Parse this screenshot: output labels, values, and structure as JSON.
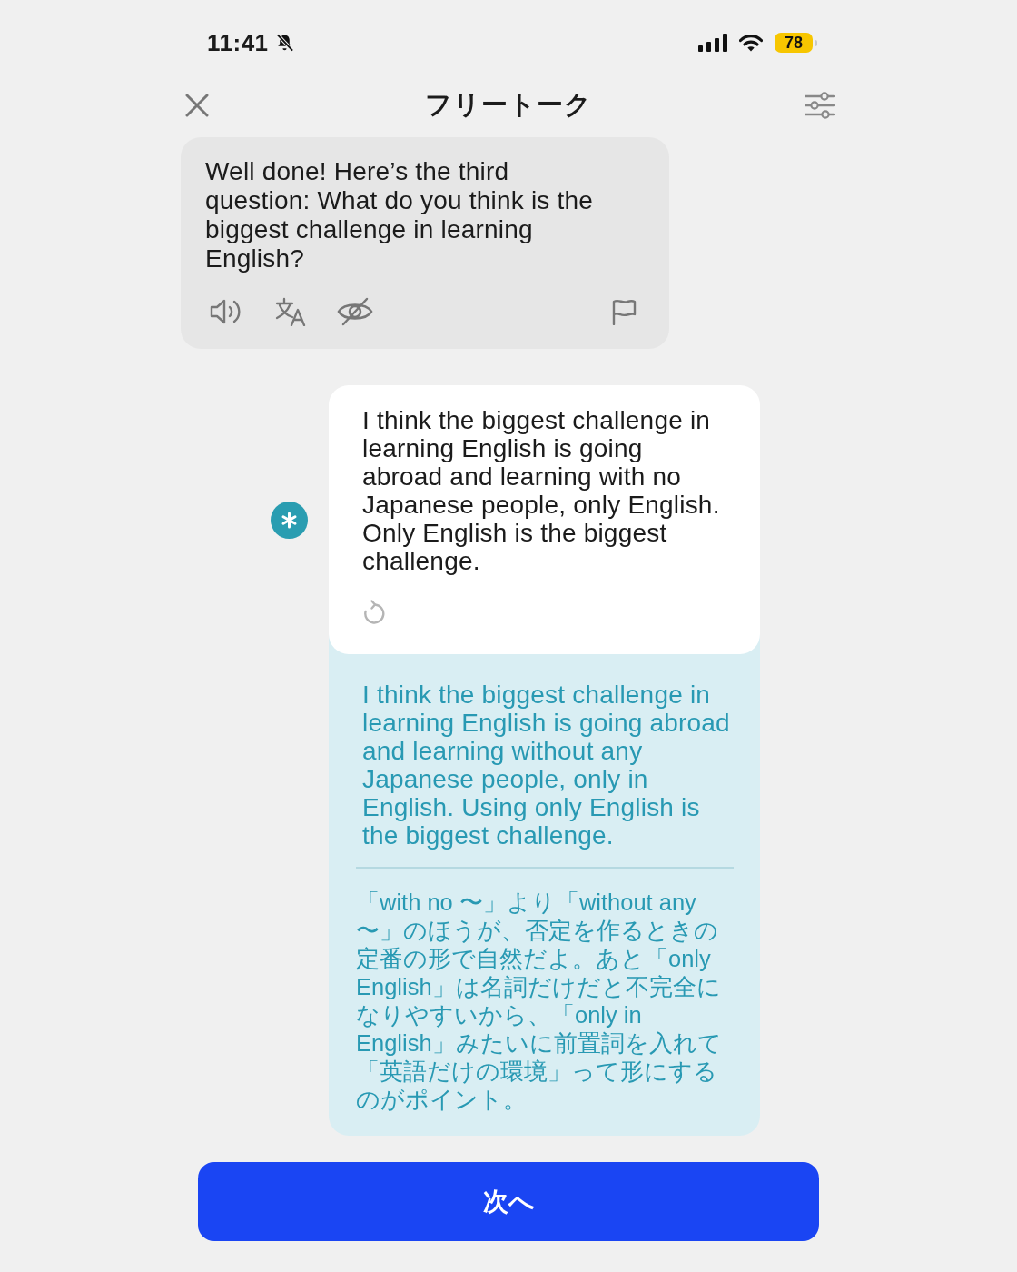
{
  "status_bar": {
    "time": "11:41",
    "battery": "78"
  },
  "nav": {
    "title": "フリートーク"
  },
  "ai_message": {
    "text": "Well done! Here’s the third question: What do you think is the biggest challenge in learning English?"
  },
  "user_message": {
    "text": "I think the biggest challenge in learning English is going abroad and learning with no Japanese people, only English. Only English is the biggest challenge."
  },
  "feedback": {
    "corrected_text": "I think the biggest challenge in learning English is going abroad and learning without any Japanese people, only in English. Using only English is the biggest challenge.",
    "explanation": "「with no 〜」より「without any 〜」のほうが、否定を作るときの定番の形で自然だよ。あと「only English」は名詞だけだと不完全になりやすいから、「only in English」みたいに前置詞を入れて「英語だけの環境」って形にするのがポイント。"
  },
  "next_button": {
    "label": "次へ"
  }
}
